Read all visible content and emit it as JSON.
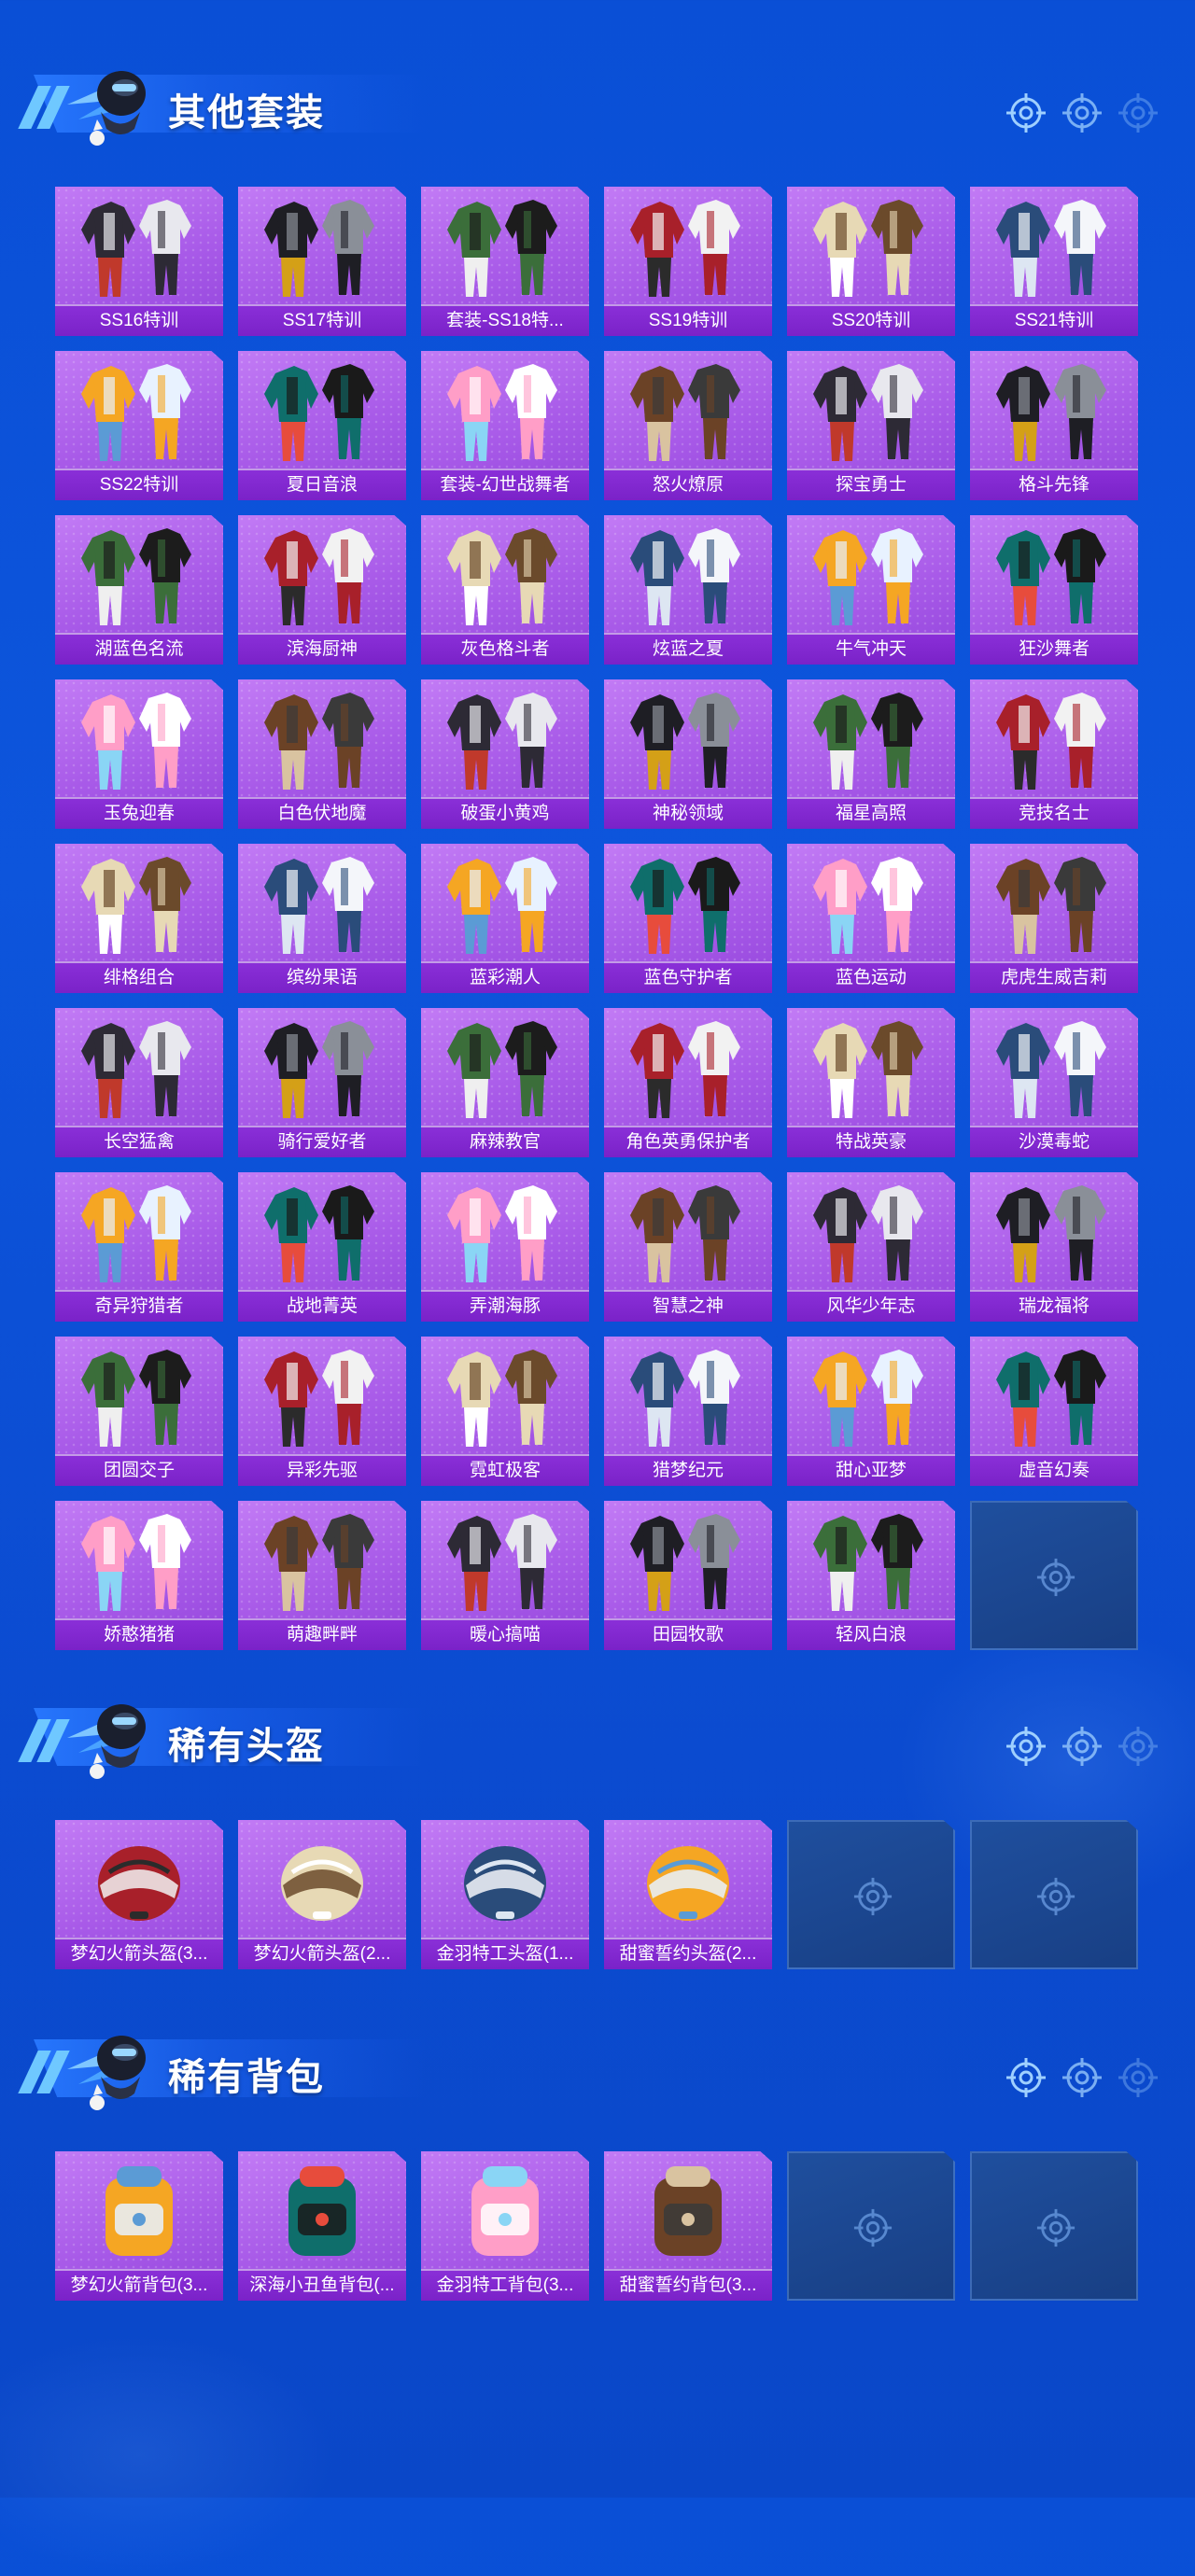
{
  "colors": {
    "background": "#0b4fd6",
    "tile_purple": "#a85ae8",
    "label_bar": "#7a22c8",
    "empty_tile": "#1d4a96",
    "header_accent": "#6fc8ff"
  },
  "sections": [
    {
      "id": "outfits",
      "title": "其他套装",
      "items": [
        {
          "label": "SS16特训",
          "icon": "outfit-icon"
        },
        {
          "label": "SS17特训",
          "icon": "outfit-icon"
        },
        {
          "label": "套装-SS18特...",
          "icon": "outfit-icon"
        },
        {
          "label": "SS19特训",
          "icon": "outfit-icon"
        },
        {
          "label": "SS20特训",
          "icon": "outfit-icon"
        },
        {
          "label": "SS21特训",
          "icon": "outfit-icon"
        },
        {
          "label": "SS22特训",
          "icon": "outfit-icon"
        },
        {
          "label": "夏日音浪",
          "icon": "outfit-icon"
        },
        {
          "label": "套装-幻世战舞者",
          "icon": "outfit-icon"
        },
        {
          "label": "怒火燎原",
          "icon": "outfit-icon"
        },
        {
          "label": "探宝勇士",
          "icon": "outfit-icon"
        },
        {
          "label": "格斗先锋",
          "icon": "outfit-icon"
        },
        {
          "label": "湖蓝色名流",
          "icon": "outfit-icon"
        },
        {
          "label": "滨海厨神",
          "icon": "outfit-icon"
        },
        {
          "label": "灰色格斗者",
          "icon": "outfit-icon"
        },
        {
          "label": "炫蓝之夏",
          "icon": "outfit-icon"
        },
        {
          "label": "牛气冲天",
          "icon": "outfit-icon"
        },
        {
          "label": "狂沙舞者",
          "icon": "outfit-icon"
        },
        {
          "label": "玉兔迎春",
          "icon": "outfit-icon"
        },
        {
          "label": "白色伏地魔",
          "icon": "outfit-icon"
        },
        {
          "label": "破蛋小黄鸡",
          "icon": "outfit-icon"
        },
        {
          "label": "神秘领域",
          "icon": "outfit-icon"
        },
        {
          "label": "福星高照",
          "icon": "outfit-icon"
        },
        {
          "label": "竞技名士",
          "icon": "outfit-icon"
        },
        {
          "label": "绯格组合",
          "icon": "outfit-icon"
        },
        {
          "label": "缤纷果语",
          "icon": "outfit-icon"
        },
        {
          "label": "蓝彩潮人",
          "icon": "outfit-icon"
        },
        {
          "label": "蓝色守护者",
          "icon": "outfit-icon"
        },
        {
          "label": "蓝色运动",
          "icon": "outfit-icon"
        },
        {
          "label": "虎虎生威吉莉",
          "icon": "outfit-icon"
        },
        {
          "label": "长空猛禽",
          "icon": "outfit-icon"
        },
        {
          "label": "骑行爱好者",
          "icon": "outfit-icon"
        },
        {
          "label": "麻辣教官",
          "icon": "outfit-icon"
        },
        {
          "label": "角色英勇保护者",
          "icon": "outfit-icon"
        },
        {
          "label": "特战英豪",
          "icon": "outfit-icon"
        },
        {
          "label": "沙漠毒蛇",
          "icon": "outfit-icon"
        },
        {
          "label": "奇异狩猎者",
          "icon": "outfit-icon"
        },
        {
          "label": "战地菁英",
          "icon": "outfit-icon"
        },
        {
          "label": "弄潮海豚",
          "icon": "outfit-icon"
        },
        {
          "label": "智慧之神",
          "icon": "outfit-icon"
        },
        {
          "label": "风华少年志",
          "icon": "outfit-icon"
        },
        {
          "label": "瑞龙福将",
          "icon": "outfit-icon"
        },
        {
          "label": "团圆交子",
          "icon": "outfit-icon"
        },
        {
          "label": "异彩先驱",
          "icon": "outfit-icon"
        },
        {
          "label": "霓虹极客",
          "icon": "outfit-icon"
        },
        {
          "label": "猎梦纪元",
          "icon": "outfit-icon"
        },
        {
          "label": "甜心亚梦",
          "icon": "outfit-icon"
        },
        {
          "label": "虚音幻奏",
          "icon": "outfit-icon"
        },
        {
          "label": "娇憨猪猪",
          "icon": "outfit-icon"
        },
        {
          "label": "萌趣畔畔",
          "icon": "outfit-icon"
        },
        {
          "label": "暖心搞喵",
          "icon": "outfit-icon"
        },
        {
          "label": "田园牧歌",
          "icon": "outfit-icon"
        },
        {
          "label": "轻风白浪",
          "icon": "outfit-icon"
        }
      ],
      "empty_slots": 1
    },
    {
      "id": "helmets",
      "title": "稀有头盔",
      "items": [
        {
          "label": "梦幻火箭头盔(3...",
          "icon": "helmet-icon"
        },
        {
          "label": "梦幻火箭头盔(2...",
          "icon": "helmet-icon"
        },
        {
          "label": "金羽特工头盔(1...",
          "icon": "helmet-icon"
        },
        {
          "label": "甜蜜誓约头盔(2...",
          "icon": "helmet-icon"
        }
      ],
      "empty_slots": 2
    },
    {
      "id": "backpacks",
      "title": "稀有背包",
      "items": [
        {
          "label": "梦幻火箭背包(3...",
          "icon": "backpack-icon"
        },
        {
          "label": "深海小丑鱼背包(...",
          "icon": "backpack-icon"
        },
        {
          "label": "金羽特工背包(3...",
          "icon": "backpack-icon"
        },
        {
          "label": "甜蜜誓约背包(3...",
          "icon": "backpack-icon"
        }
      ],
      "empty_slots": 2
    }
  ]
}
